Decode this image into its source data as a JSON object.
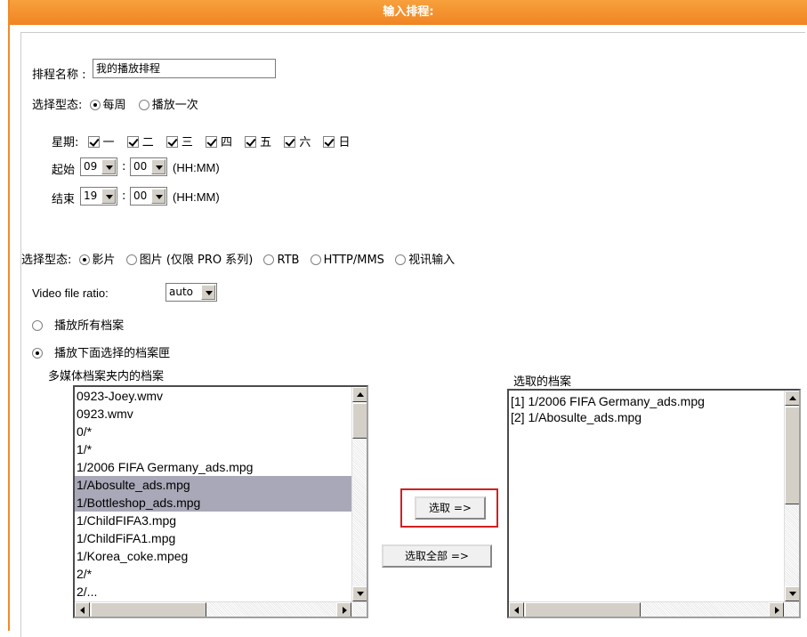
{
  "header": {
    "title": "输入排程:"
  },
  "schedule": {
    "name_label": "排程名称 :",
    "name_value": "我的播放排程",
    "type_label": "选择型态:",
    "type_options": [
      "每周",
      "播放一次"
    ],
    "weekday_label": "星期:",
    "weekdays": [
      "一",
      "二",
      "三",
      "四",
      "五",
      "六",
      "日"
    ],
    "start_label": "起始",
    "start_hour": "09",
    "start_min": "00",
    "end_label": "结束",
    "end_hour": "19",
    "end_min": "00",
    "colon": ":",
    "hhmm": "(HH:MM)"
  },
  "source": {
    "type_label": "选择型态:",
    "options": [
      "影片",
      "图片 (仅限 PRO 系列)",
      "RTB",
      "HTTP/MMS",
      "视讯输入"
    ],
    "ratio_label": "Video file ratio:",
    "ratio_value": "auto",
    "play_all": "播放所有档案",
    "play_selected": "播放下面选择的档案匣"
  },
  "files": {
    "left_label": "多媒体档案夹内的档案",
    "right_label": "选取的档案",
    "left_items": [
      "0923-Joey.wmv",
      "0923.wmv",
      "0/*",
      "1/*",
      "1/2006 FIFA Germany_ads.mpg",
      "1/Abosulte_ads.mpg",
      "1/Bottleshop_ads.mpg",
      "1/ChildFIFA3.mpg",
      "1/ChildFiFA1.mpg",
      "1/Korea_coke.mpeg",
      "2/*",
      "2/..."
    ],
    "right_items": [
      "[1] 1/2006 FIFA Germany_ads.mpg",
      "[2] 1/Abosulte_ads.mpg"
    ],
    "select_button": "选取 =>",
    "select_all_button": "选取全部 =>"
  },
  "colors": {
    "header": "#f08a2a",
    "highlight": "#d32020",
    "selected_row": "#a8a8b8"
  }
}
